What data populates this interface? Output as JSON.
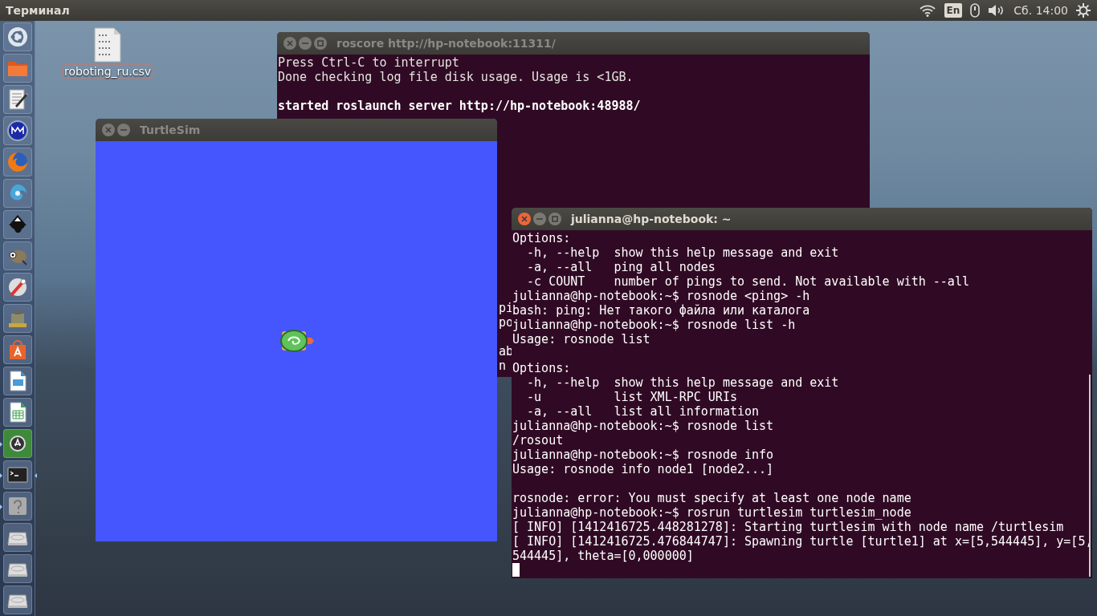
{
  "top_panel": {
    "app_title": "Терминал",
    "keyboard_layout": "En",
    "clock": "Сб. 14:00"
  },
  "launcher": [
    {
      "kind": "dash",
      "running": false,
      "active": false
    },
    {
      "kind": "folder",
      "running": false,
      "active": false
    },
    {
      "kind": "editor",
      "running": false,
      "active": false
    },
    {
      "kind": "mc",
      "running": false,
      "active": false
    },
    {
      "kind": "browser",
      "running": false,
      "active": false
    },
    {
      "kind": "swirl",
      "running": false,
      "active": false
    },
    {
      "kind": "ink",
      "running": false,
      "active": false
    },
    {
      "kind": "paint",
      "running": false,
      "active": false
    },
    {
      "kind": "tools",
      "running": false,
      "active": false
    },
    {
      "kind": "blurred",
      "running": false,
      "active": false
    },
    {
      "kind": "store",
      "running": false,
      "active": false
    },
    {
      "kind": "slides",
      "running": false,
      "active": false
    },
    {
      "kind": "sheet",
      "running": false,
      "active": false
    },
    {
      "kind": "updater",
      "running": true,
      "active": false
    },
    {
      "kind": "terminal",
      "running": true,
      "active": true
    },
    {
      "kind": "help",
      "running": true,
      "active": false
    },
    {
      "kind": "disk",
      "running": false,
      "active": false
    },
    {
      "kind": "disk",
      "running": false,
      "active": false
    },
    {
      "kind": "disk",
      "running": false,
      "active": false
    }
  ],
  "desktop_file": {
    "label": "roboting_ru.csv"
  },
  "roscore_window": {
    "title": "roscore http://hp-notebook:11311/",
    "focused": false,
    "blocks": [
      [
        {
          "text": "Press Ctrl-C to interrupt",
          "bold": false
        },
        {
          "text": "Done checking log file disk usage. Usage is <1GB.",
          "bold": false
        }
      ],
      [
        {
          "text": "started roslaunch server http://hp-notebook:48988/",
          "bold": true
        }
      ]
    ],
    "hidden_fragments": [
      "pi",
      "po",
      "ab",
      "n"
    ]
  },
  "turtlesim_window": {
    "title": "TurtleSim",
    "focused": false
  },
  "terminal_window": {
    "title": "julianna@hp-notebook: ~",
    "focused": true,
    "blocks": [
      [
        "Options:",
        "  -h, --help  show this help message and exit",
        "  -a, --all   ping all nodes",
        "  -c COUNT    number of pings to send. Not available with --all",
        "julianna@hp-notebook:~$ rosnode <ping> -h",
        "bash: ping: Нет такого файла или каталога",
        "julianna@hp-notebook:~$ rosnode list -h",
        "Usage: rosnode list"
      ],
      [
        "Options:",
        "  -h, --help  show this help message and exit",
        "  -u          list XML-RPC URIs",
        "  -a, --all   list all information",
        "julianna@hp-notebook:~$ rosnode list",
        "/rosout",
        "julianna@hp-notebook:~$ rosnode info",
        "Usage: rosnode info node1 [node2...]"
      ],
      [
        "rosnode: error: You must specify at least one node name",
        "julianna@hp-notebook:~$ rosrun turtlesim turtlesim_node",
        "[ INFO] [1412416725.448281278]: Starting turtlesim with node name /turtlesim",
        "[ INFO] [1412416725.476844747]: Spawning turtle [turtle1] at x=[5,544445], y=[5,",
        "544445], theta=[0,000000]"
      ]
    ]
  }
}
